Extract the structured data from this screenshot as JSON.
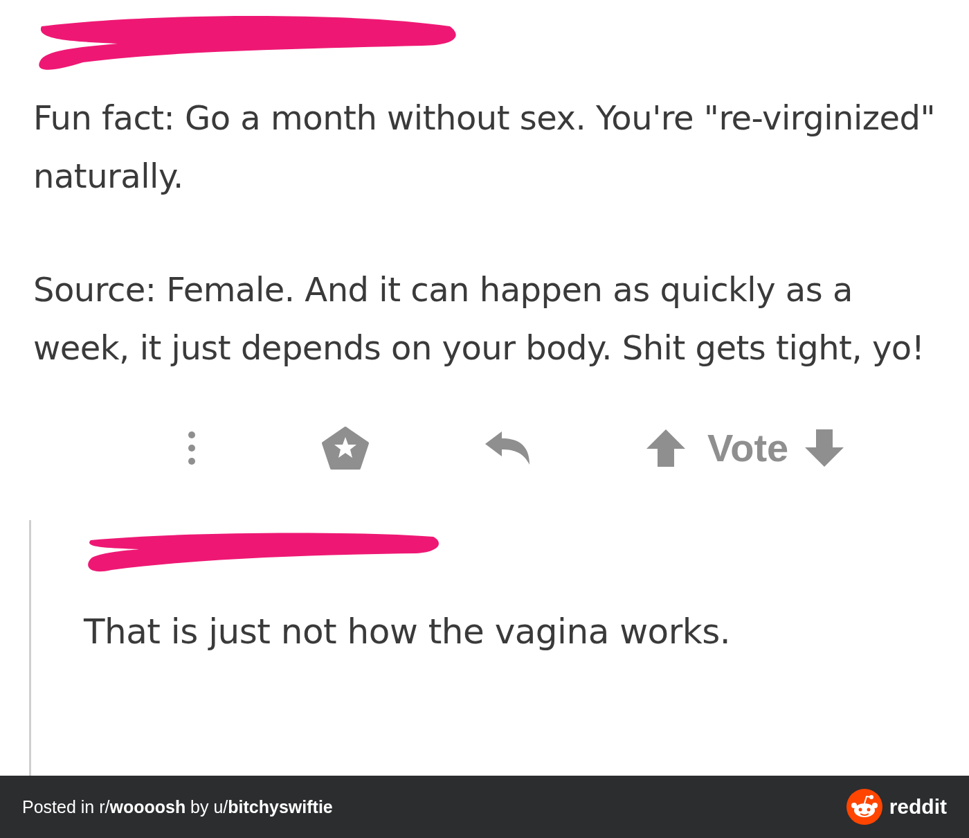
{
  "comment": {
    "paragraphs": [
      "Fun fact: Go a month without sex. You're \"re-virginized\" naturally.",
      "Source: Female. And it can happen as quickly as a week, it just depends on your body. Shit gets tight, yo!"
    ],
    "vote_label": "Vote"
  },
  "reply": {
    "body": "That is just not how the vagina works."
  },
  "footer": {
    "caption": "Posted in r/**woooosh** by u/**bitchyswiftie**",
    "brand": "reddit"
  }
}
